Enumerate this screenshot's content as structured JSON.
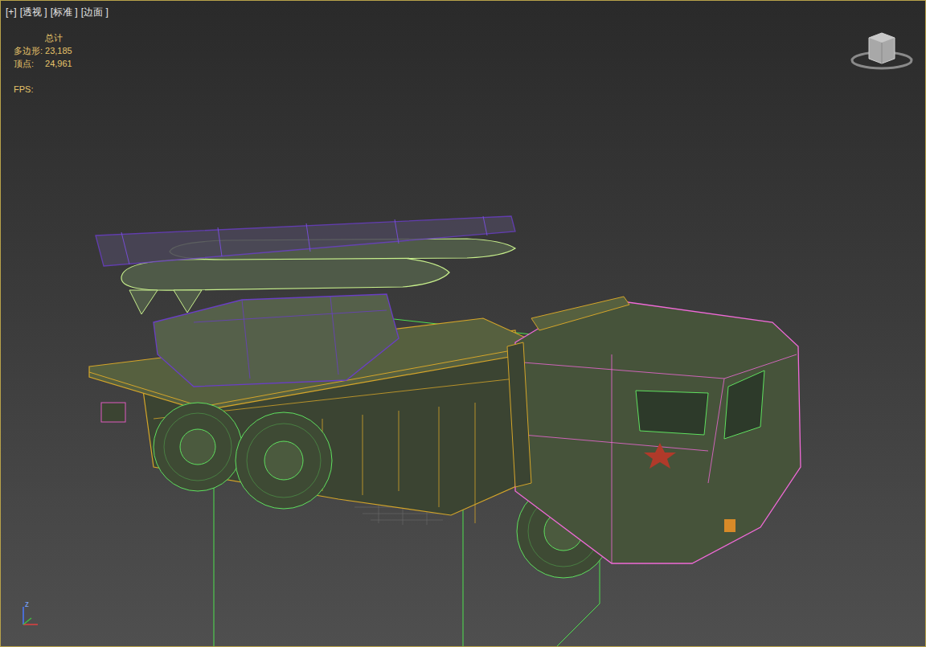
{
  "viewport": {
    "labels": [
      {
        "text": "[+]"
      },
      {
        "text": "[透视 ]"
      },
      {
        "text": "[标准 ]"
      },
      {
        "text": "[边面 ]"
      }
    ]
  },
  "stats": {
    "header": "总计",
    "rows": [
      {
        "label": "多边形:",
        "value": "23,185"
      },
      {
        "label": "顶点:",
        "value": "24,961"
      }
    ],
    "fps_label": "FPS:"
  },
  "axis": {
    "labels": [
      "z"
    ]
  }
}
